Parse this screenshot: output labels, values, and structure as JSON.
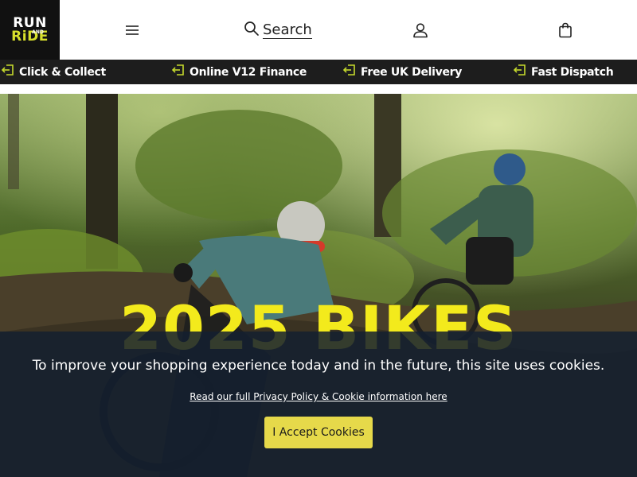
{
  "header": {
    "logo_line1": "RUN",
    "logo_amp": "AND",
    "logo_line2": "RiDE",
    "search_label": "Search",
    "icons": {
      "menu": "hamburger-menu-icon",
      "search": "search-icon",
      "account": "user-icon",
      "bag": "shopping-bag-icon"
    }
  },
  "usp_bar": {
    "items": [
      {
        "label": "Click & Collect",
        "icon": "exit-icon"
      },
      {
        "label": "Online V12 Finance",
        "icon": "exit-icon"
      },
      {
        "label": "Free UK Delivery",
        "icon": "exit-icon"
      },
      {
        "label": "Fast Dispatch",
        "icon": "exit-icon"
      }
    ],
    "icon_color": "#c5d92d"
  },
  "hero": {
    "title": "2025 BIKES",
    "title_color": "#f3ea1c"
  },
  "cookie_banner": {
    "message": "To improve your shopping experience today and in the future, this site uses cookies.",
    "policy_link": "Read our full Privacy Policy & Cookie information here",
    "accept_label": "I Accept Cookies",
    "accept_color": "#e6d94a"
  }
}
